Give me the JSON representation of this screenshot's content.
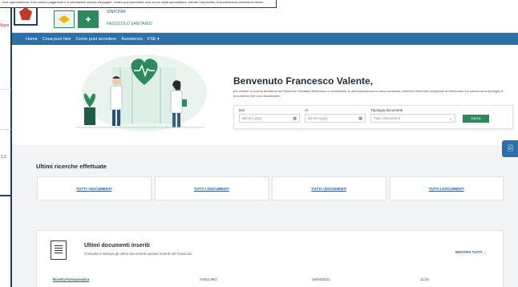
{
  "background": {
    "notice_text": "i tuoi appuntamenti, il tuo storico pagamenti e le prestazioni ancora da pagare. Inoltre puoi prenotare una nuova visita specialistica, tramite l'Impresidio di Accettazione prestazioni online.",
    "left_label": "Apps",
    "left_number": "1.2"
  },
  "header": {
    "brand_line1": "SINFONIA",
    "brand_line2": "FASCICOLO SANITARIO"
  },
  "nav": {
    "items": [
      {
        "label": "Home"
      },
      {
        "label": "Cosa puoi fare"
      },
      {
        "label": "Come puoi accedere"
      },
      {
        "label": "Assistenza"
      },
      {
        "label": "FSE ▾"
      }
    ]
  },
  "hero": {
    "title": "Benvenuto Francesco Valente,",
    "subtitle": "per iniziare la ricerca all'interno del Fascicolo Sanitario Elettronico e consultarne la documentazione in esso contenuta, inserisci l'intervallo temporale di riferimento e/o seleziona la tipologia di documento che vuoi visualizzare."
  },
  "search": {
    "from_label": "Dal",
    "from_placeholder": "dd-mm-yyyy",
    "to_label": "Al",
    "to_placeholder": "dd-mm-yyyy",
    "type_label": "Tipologia documenti",
    "type_value": "Tutti i documenti",
    "button": "Cerca"
  },
  "recent": {
    "title": "Ultimi ricerche effettuate",
    "cards": [
      {
        "label": "TUTTI I DOCUMENTI"
      },
      {
        "label": "TUTTI I DOCUMENTI"
      },
      {
        "label": "TUTTI I DOCUMENTI"
      },
      {
        "label": "TUTTI I DOCUMENTI"
      }
    ]
  },
  "documents": {
    "title": "Ultimi documenti inseriti",
    "subtitle": "Consulta e stampa gli ultimi documenti sanitari inseriti nel Fascicolo",
    "show_all": "MOSTRA TUTTI →",
    "rows": [
      {
        "type": "Ricetta Farmaceutica",
        "place": "AVELLINO",
        "date": "15/04/2021",
        "time": "11:24"
      }
    ]
  },
  "colors": {
    "nav": "#2d6fa8",
    "accent_green": "#2d8a5a",
    "link": "#2d5aa0"
  }
}
